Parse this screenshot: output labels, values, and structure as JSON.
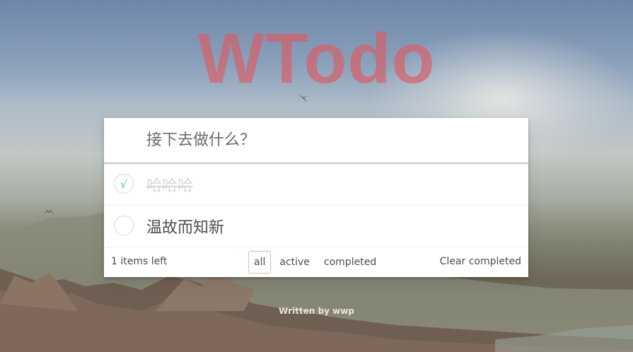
{
  "header": {
    "title": "WTodo"
  },
  "new_todo": {
    "placeholder": "接下去做什么？",
    "value": ""
  },
  "todos": [
    {
      "label": "哈哈哈",
      "completed": true,
      "check_glyph": "√"
    },
    {
      "label": "温故而知新",
      "completed": false,
      "check_glyph": ""
    }
  ],
  "footer": {
    "count_text": "1 items left",
    "filters": [
      {
        "label": "all",
        "selected": true
      },
      {
        "label": "active",
        "selected": false
      },
      {
        "label": "completed",
        "selected": false
      }
    ],
    "clear_label": "Clear completed"
  },
  "credit": "Written by wwp",
  "colors": {
    "title": "#d66068",
    "check": "#5dc2af",
    "filter_border": "#af2f2f"
  }
}
